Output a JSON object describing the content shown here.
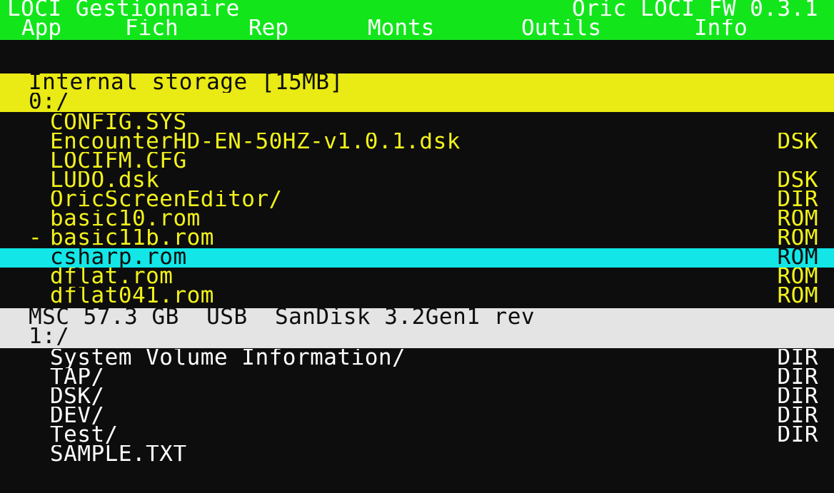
{
  "header": {
    "app_title": "LOCI Gestionnaire",
    "firmware": "Oric LOCI FW 0.3.1"
  },
  "menu": {
    "items": [
      "App",
      "Fich",
      "Rep",
      "Monts",
      "Outils",
      "Info"
    ]
  },
  "internal": {
    "device_label": "Internal storage [15MB]",
    "path": "0:/",
    "files": [
      {
        "marker": " ",
        "name": "CONFIG.SYS",
        "type": ""
      },
      {
        "marker": " ",
        "name": "EncounterHD-EN-50HZ-v1.0.1.dsk",
        "type": "DSK"
      },
      {
        "marker": " ",
        "name": "LOCIFM.CFG",
        "type": ""
      },
      {
        "marker": " ",
        "name": "LUDO.dsk",
        "type": "DSK"
      },
      {
        "marker": " ",
        "name": "OricScreenEditor/",
        "type": "DIR"
      },
      {
        "marker": " ",
        "name": "basic10.rom",
        "type": "ROM"
      },
      {
        "marker": "-",
        "name": "basic11b.rom",
        "type": "ROM"
      },
      {
        "marker": " ",
        "name": "csharp.rom",
        "type": "ROM",
        "selected": true
      },
      {
        "marker": " ",
        "name": "dflat.rom",
        "type": "ROM"
      },
      {
        "marker": " ",
        "name": "dflat041.rom",
        "type": "ROM"
      }
    ]
  },
  "usb": {
    "device_label": "MSC 57.3 GB  USB  SanDisk 3.2Gen1 rev",
    "path": "1:/",
    "files": [
      {
        "marker": " ",
        "name": "System Volume Information/",
        "type": "DIR"
      },
      {
        "marker": " ",
        "name": "TAP/",
        "type": "DIR"
      },
      {
        "marker": " ",
        "name": "DSK/",
        "type": "DIR"
      },
      {
        "marker": " ",
        "name": "DEV/",
        "type": "DIR"
      },
      {
        "marker": " ",
        "name": "Test/",
        "type": "DIR"
      },
      {
        "marker": " ",
        "name": "SAMPLE.TXT",
        "type": ""
      }
    ]
  },
  "colors": {
    "title_bar": "#12e61b",
    "internal_header": "#eaea14",
    "usb_header": "#e4e4e4",
    "selection": "#12e6e6",
    "file_text_internal": "#f2f21a",
    "file_text_usb": "#ffffff",
    "background": "#0d0d0d"
  }
}
